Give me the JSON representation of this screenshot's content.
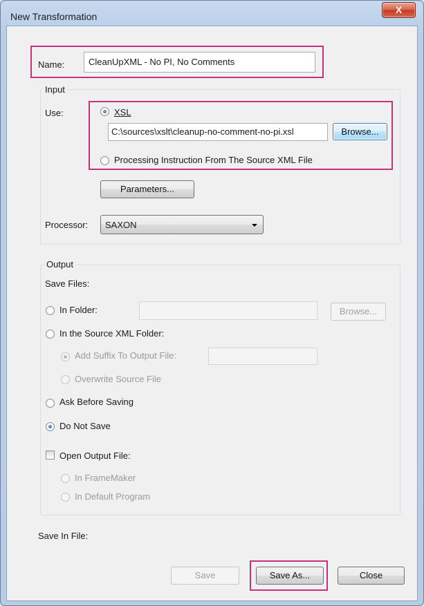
{
  "window": {
    "title": "New Transformation",
    "close_glyph": "X"
  },
  "name": {
    "label": "Name:",
    "value": "CleanUpXML - No PI, No Comments"
  },
  "input": {
    "group_title": "Input",
    "use_label": "Use:",
    "xsl": {
      "label": "XSL",
      "selected": true
    },
    "xsl_path": "C:\\sources\\xslt\\cleanup-no-comment-no-pi.xsl",
    "browse_label": "Browse...",
    "pi": {
      "label": "Processing Instruction From The Source XML File",
      "selected": false
    },
    "parameters_label": "Parameters...",
    "processor_label": "Processor:",
    "processor_value": "SAXON"
  },
  "output": {
    "group_title": "Output",
    "save_files_label": "Save Files:",
    "in_folder": {
      "label": "In Folder:",
      "browse": "Browse..."
    },
    "in_source": {
      "label": "In the Source XML Folder:"
    },
    "add_suffix": {
      "label": "Add Suffix To Output File:"
    },
    "overwrite": {
      "label": "Overwrite Source File"
    },
    "ask_before": {
      "label": "Ask Before Saving"
    },
    "do_not_save": {
      "label": "Do Not Save",
      "selected": true
    },
    "open_output": {
      "label": "Open Output File:",
      "checked": false
    },
    "in_framemaker": {
      "label": "In FrameMaker"
    },
    "in_default": {
      "label": "In Default Program"
    }
  },
  "save_in_file_label": "Save In File:",
  "buttons": {
    "save": "Save",
    "save_as": "Save As...",
    "close": "Close"
  }
}
